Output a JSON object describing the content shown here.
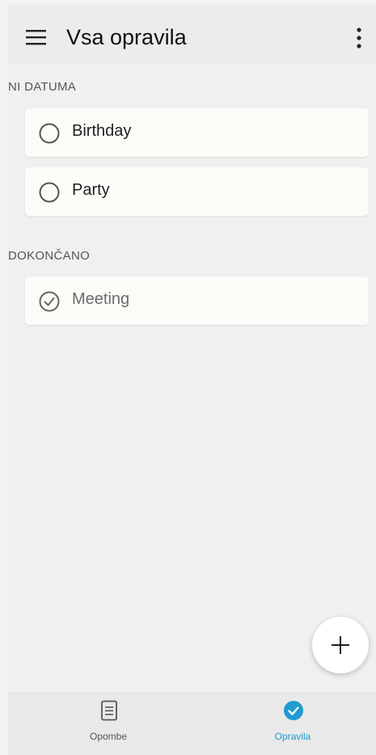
{
  "header": {
    "title": "Vsa opravila",
    "menu_icon": "hamburger-menu-icon",
    "more_icon": "more-vertical-icon"
  },
  "sections": [
    {
      "label": "NI DATUMA",
      "items": [
        {
          "label": "Birthday",
          "completed": false
        },
        {
          "label": "Party",
          "completed": false
        }
      ]
    },
    {
      "label": "DOKONČANO",
      "items": [
        {
          "label": "Meeting",
          "completed": true
        }
      ]
    }
  ],
  "fab": {
    "icon": "plus-icon"
  },
  "bottom_nav": {
    "items": [
      {
        "label": "Opombe",
        "icon": "note-icon",
        "active": false
      },
      {
        "label": "Opravila",
        "icon": "check-circle-icon",
        "active": true
      }
    ]
  },
  "colors": {
    "accent": "#1f9bd0",
    "background": "#f0f0f0",
    "card": "#fbfbf8"
  }
}
